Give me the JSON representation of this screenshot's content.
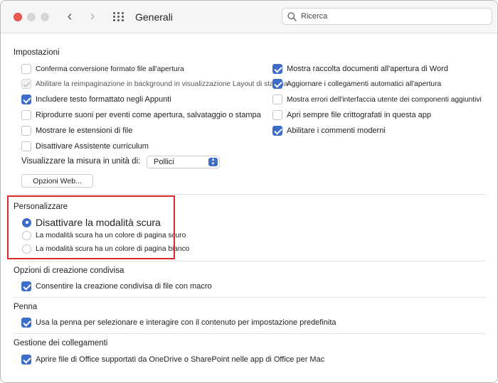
{
  "window": {
    "title": "Generali"
  },
  "search": {
    "placeholder": "Ricerca"
  },
  "impostazioni": {
    "title": "Impostazioni",
    "left": [
      {
        "label": "Conferma conversione formato file all'apertura",
        "checked": false
      },
      {
        "label": "Abilitare la reimpaginazione in background in visualizzazione Layout di stampa",
        "checked": true,
        "disabled": true
      },
      {
        "label": "Includere testo formattato negli Appunti",
        "checked": true
      },
      {
        "label": "Riprodurre suoni per eventi come apertura, salvataggio o stampa",
        "checked": false
      },
      {
        "label": "Mostrare le estensioni di file",
        "checked": false
      },
      {
        "label": "Disattivare Assistente curriculum",
        "checked": false
      }
    ],
    "right": [
      {
        "label": "Mostra raccolta documenti all'apertura di Word",
        "checked": true
      },
      {
        "label": "Aggiornare i collegamenti automatici all'apertura",
        "checked": true
      },
      {
        "label": "Mostra errori dell'interfaccia utente dei componenti aggiuntivi",
        "checked": false
      },
      {
        "label": "Apri sempre file crittografati in questa app",
        "checked": false
      },
      {
        "label": "Abilitare i commenti moderni",
        "checked": true
      }
    ],
    "measure_label": "Visualizzare la misura in unità di:",
    "measure_value": "Pollici",
    "web_button": "Opzioni Web..."
  },
  "personalizzare": {
    "title": "Personalizzare",
    "options": [
      {
        "label": "Disattivare la modalità scura",
        "selected": true
      },
      {
        "label": "La modalità scura ha un colore di pagina scuro",
        "selected": false
      },
      {
        "label": "La modalità scura ha un colore di pagina bianco",
        "selected": false
      }
    ]
  },
  "coauthoring": {
    "title": "Opzioni di creazione condivisa",
    "option": "Consentire la creazione condivisa di file con macro"
  },
  "pen": {
    "title": "Penna",
    "option": "Usa la penna per selezionare e interagire con il contenuto per impostazione predefinita"
  },
  "links": {
    "title": "Gestione dei collegamenti",
    "option": "Aprire file di Office supportati da OneDrive o SharePoint nelle app di Office per Mac"
  },
  "colors": {
    "accent": "#3e6cc9",
    "highlight": "#d72b2b",
    "close": "#ee5b55"
  }
}
